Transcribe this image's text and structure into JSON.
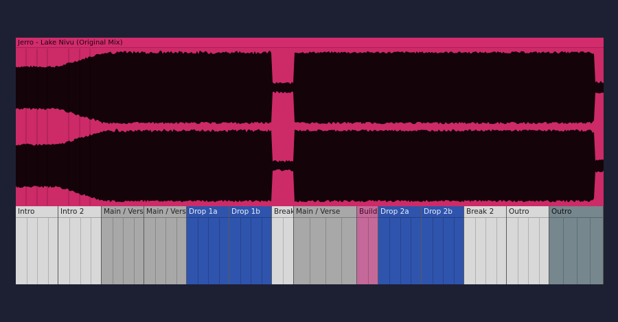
{
  "clip": {
    "title": "Jerro - Lake Nivu (Original Mix)",
    "color": "#d22c6d",
    "waveform_color": "#140309"
  },
  "sections": [
    {
      "label": "Intro",
      "color": "#d8d8d8",
      "text_color": "#222222"
    },
    {
      "label": "Intro 2",
      "color": "#d8d8d8",
      "text_color": "#222222"
    },
    {
      "label": "Main / Verse",
      "color": "#a8a8a8",
      "text_color": "#222222"
    },
    {
      "label": "Main / Verse",
      "color": "#a8a8a8",
      "text_color": "#222222"
    },
    {
      "label": "Drop 1a",
      "color": "#2f54ad",
      "text_color": "#e8ecf8"
    },
    {
      "label": "Drop 1b",
      "color": "#2f54ad",
      "text_color": "#e8ecf8"
    },
    {
      "label": "Break",
      "color": "#d8d8d8",
      "text_color": "#222222"
    },
    {
      "label": "Main / Verse",
      "color": "#a8a8a8",
      "text_color": "#222222"
    },
    {
      "label": "Build",
      "color": "#c5689a",
      "text_color": "#3a0f24"
    },
    {
      "label": "Drop 2a",
      "color": "#2f54ad",
      "text_color": "#e8ecf8"
    },
    {
      "label": "Drop 2b",
      "color": "#2f54ad",
      "text_color": "#e8ecf8"
    },
    {
      "label": "Break 2",
      "color": "#d8d8d8",
      "text_color": "#222222"
    },
    {
      "label": "Outro",
      "color": "#d8d8d8",
      "text_color": "#222222"
    },
    {
      "label": "Outro",
      "color": "#76878e",
      "text_color": "#111111"
    }
  ]
}
